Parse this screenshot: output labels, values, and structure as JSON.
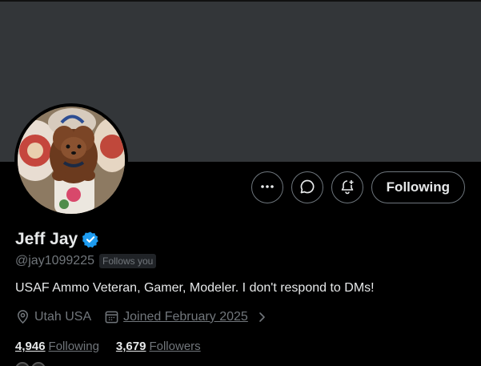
{
  "profile": {
    "display_name": "Jeff Jay",
    "handle": "@jay1099225",
    "follows_you_badge": "Follows you",
    "bio": "USAF Ammo Veteran, Gamer, Modeler. I don't respond to DMs!",
    "location": "Utah USA",
    "joined": "Joined February 2025",
    "following_count": "4,946",
    "following_label": "Following",
    "followers_count": "3,679",
    "followers_label": "Followers"
  },
  "actions": {
    "more_icon": "more-dots-icon",
    "message_icon": "message-bubble-icon",
    "notify_icon": "bell-plus-icon",
    "follow_button_label": "Following"
  },
  "colors": {
    "background": "#000000",
    "banner": "#333639",
    "verified": "#1d9bf0",
    "muted_text": "#71767b",
    "primary_text": "#e7e9ea"
  }
}
